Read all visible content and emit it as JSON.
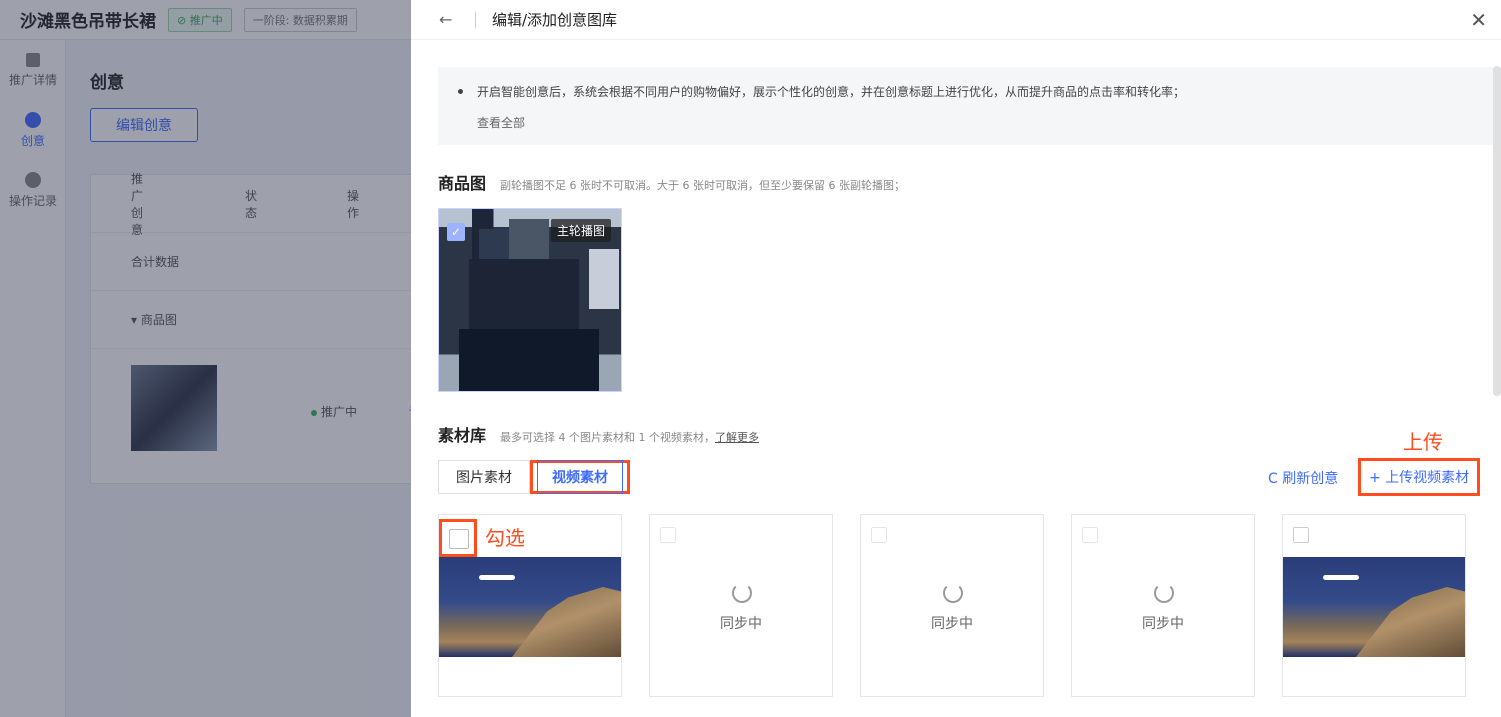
{
  "background": {
    "title": "沙滩黑色吊带长裙",
    "badge": "⊘ 推广中",
    "stage": "一阶段: 数据积累期",
    "sidebar": [
      {
        "label": "推广详情"
      },
      {
        "label": "创意"
      },
      {
        "label": "操作记录"
      }
    ],
    "section_title": "创意",
    "edit_button": "编辑创意",
    "table": {
      "headers": [
        "推广创意",
        "状态",
        "操作"
      ],
      "total_row": "合计数据",
      "group_row": "▾ 商品图",
      "status": "推广中",
      "detail_link": "详情"
    }
  },
  "drawer": {
    "back_icon": "arrow-left-icon",
    "title": "编辑/添加创意图库",
    "close_icon": "close-icon",
    "notice": {
      "text": "开启智能创意后，系统会根据不同用户的购物偏好，展示个性化的创意，并在创意标题上进行优化，从而提升商品的点击率和转化率；",
      "more": "查看全部"
    },
    "product_section": {
      "title": "商品图",
      "desc": "副轮播图不足 6 张时不可取消。大于 6 张时可取消，但至少要保留 6 张副轮播图；",
      "main_tag": "主轮播图"
    },
    "library_section": {
      "title": "素材库",
      "desc": "最多可选择 4 个图片素材和 1 个视频素材，",
      "learn_more": "了解更多"
    },
    "tabs": [
      {
        "label": "图片素材",
        "active": false
      },
      {
        "label": "视频素材",
        "active": true
      }
    ],
    "refresh": "C 刷新创意",
    "upload": "+ 上传视频素材",
    "annotations": {
      "upload": "上传",
      "check": "勾选"
    },
    "cards": [
      {
        "type": "video"
      },
      {
        "type": "syncing",
        "label": "同步中"
      },
      {
        "type": "syncing",
        "label": "同步中"
      },
      {
        "type": "syncing",
        "label": "同步中"
      },
      {
        "type": "video"
      }
    ]
  }
}
